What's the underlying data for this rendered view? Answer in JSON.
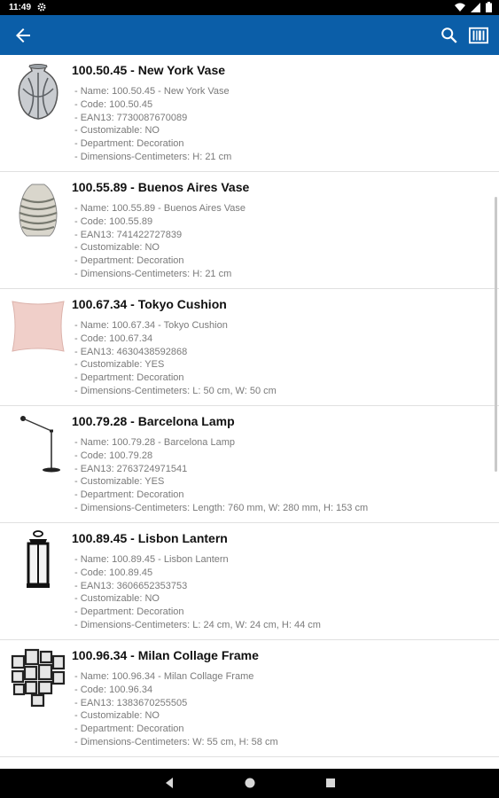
{
  "status_bar": {
    "time": "11:49"
  },
  "items": [
    {
      "title": "100.50.45 - New York Vase",
      "thumb": "vase-icon",
      "lines": [
        "- Name: 100.50.45 - New York Vase",
        "- Code: 100.50.45",
        "- EAN13: 7730087670089",
        "- Customizable: NO",
        "- Department: Decoration",
        "- Dimensions-Centimeters: H: 21 cm"
      ]
    },
    {
      "title": "100.55.89 - Buenos Aires Vase",
      "thumb": "striped-vase-icon",
      "lines": [
        "- Name: 100.55.89 - Buenos Aires Vase",
        "- Code: 100.55.89",
        "- EAN13: 741422727839",
        "- Customizable: NO",
        "- Department: Decoration",
        "- Dimensions-Centimeters: H: 21 cm"
      ]
    },
    {
      "title": "100.67.34 - Tokyo Cushion",
      "thumb": "cushion-icon",
      "lines": [
        "- Name: 100.67.34 - Tokyo Cushion",
        "- Code: 100.67.34",
        "- EAN13: 4630438592868",
        "- Customizable: YES",
        "- Department: Decoration",
        "- Dimensions-Centimeters: L: 50 cm, W: 50 cm"
      ]
    },
    {
      "title": "100.79.28 - Barcelona Lamp",
      "thumb": "floor-lamp-icon",
      "lines": [
        "- Name: 100.79.28 - Barcelona Lamp",
        "- Code: 100.79.28",
        "- EAN13: 2763724971541",
        "- Customizable: YES",
        "- Department: Decoration",
        "- Dimensions-Centimeters: Length: 760 mm, W: 280 mm, H: 153 cm"
      ]
    },
    {
      "title": "100.89.45 - Lisbon Lantern",
      "thumb": "lantern-icon",
      "lines": [
        "- Name: 100.89.45 - Lisbon Lantern",
        "- Code: 100.89.45",
        "- EAN13: 3606652353753",
        "- Customizable: NO",
        "- Department: Decoration",
        "- Dimensions-Centimeters: L: 24 cm, W: 24 cm, H: 44 cm"
      ]
    },
    {
      "title": "100.96.34 - Milan Collage Frame",
      "thumb": "collage-frame-icon",
      "lines": [
        "- Name: 100.96.34 - Milan Collage Frame",
        "- Code: 100.96.34",
        "- EAN13: 1383670255505",
        "- Customizable: NO",
        "- Department: Decoration",
        "- Dimensions-Centimeters: W: 55 cm, H: 58 cm"
      ]
    }
  ],
  "colors": {
    "app_bar": "#0b5ea8",
    "title_text": "#111111",
    "detail_text": "#7a7a7a"
  }
}
